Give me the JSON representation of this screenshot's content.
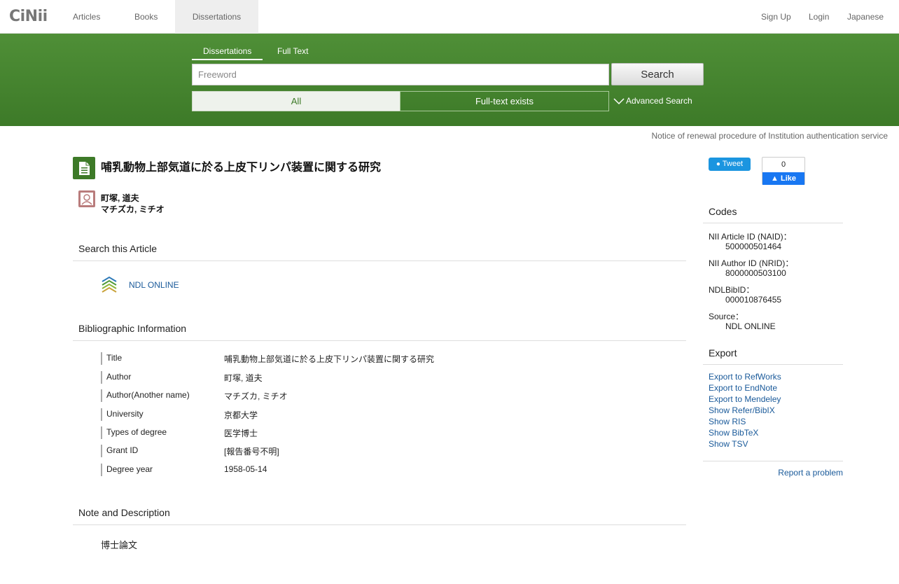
{
  "topnav": {
    "logo": "CiNii",
    "items": [
      "Articles",
      "Books",
      "Dissertations"
    ],
    "right": [
      "Sign Up",
      "Login",
      "Japanese"
    ]
  },
  "search": {
    "tabs": [
      "Dissertations",
      "Full Text"
    ],
    "placeholder": "Freeword",
    "button": "Search",
    "filter_all": "All",
    "filter_fulltext": "Full-text exists",
    "advanced": "Advanced Search"
  },
  "notice": "Notice of renewal procedure of Institution authentication service",
  "article": {
    "title": "哺乳動物上部気道に於る上皮下リンパ装置に関する研究",
    "author_name": "町塚, 道夫",
    "author_kana": "マチズカ, ミチオ"
  },
  "search_this": {
    "heading": "Search this Article",
    "link": "NDL ONLINE"
  },
  "bibliographic": {
    "heading": "Bibliographic Information",
    "rows": [
      {
        "label": "Title",
        "value": "哺乳動物上部気道に於る上皮下リンパ装置に関する研究"
      },
      {
        "label": "Author",
        "value": "町塚, 道夫"
      },
      {
        "label": "Author(Another name)",
        "value": "マチズカ, ミチオ"
      },
      {
        "label": "University",
        "value": "京都大学"
      },
      {
        "label": "Types of degree",
        "value": "医学博士"
      },
      {
        "label": "Grant ID",
        "value": "[報告番号不明]"
      },
      {
        "label": "Degree year",
        "value": "1958-05-14"
      }
    ]
  },
  "note": {
    "heading": "Note and Description",
    "text": "博士論文"
  },
  "social": {
    "tweet": "Tweet",
    "like_count": "0",
    "like": "Like"
  },
  "codes": {
    "heading": "Codes",
    "items": [
      {
        "label": "NII Article ID (NAID)：",
        "value": "500000501464"
      },
      {
        "label": "NII Author ID (NRID)：",
        "value": "8000000503100"
      },
      {
        "label": "NDLBibID：",
        "value": "000010876455"
      },
      {
        "label": "Source：",
        "value": "NDL ONLINE"
      }
    ]
  },
  "export": {
    "heading": "Export",
    "links": [
      "Export to RefWorks",
      "Export to EndNote",
      "Export to Mendeley",
      "Show Refer/BibIX",
      "Show RIS",
      "Show BibTeX",
      "Show TSV"
    ]
  },
  "report": "Report a problem",
  "colors": {
    "brand_green": "#3d7a28",
    "link": "#1a5a9a"
  }
}
